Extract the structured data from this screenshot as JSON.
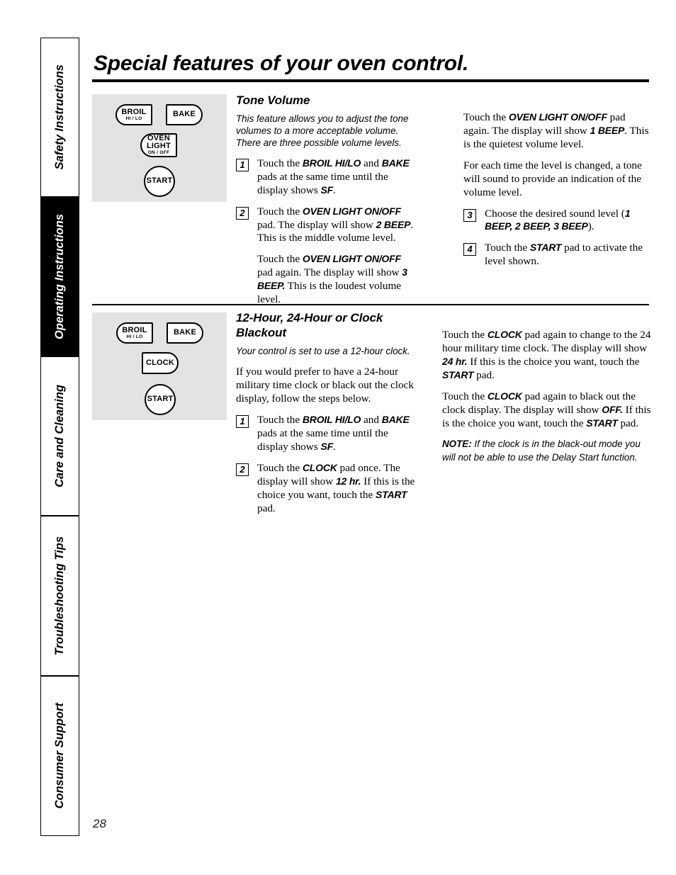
{
  "page": {
    "title": "Special features of your oven control.",
    "number": "28"
  },
  "sidebar": {
    "tabs": [
      {
        "label": "Safety Instructions",
        "active": false
      },
      {
        "label": "Operating Instructions",
        "active": true
      },
      {
        "label": "Care and Cleaning",
        "active": false
      },
      {
        "label": "Troubleshooting Tips",
        "active": false
      },
      {
        "label": "Consumer Support",
        "active": false
      }
    ]
  },
  "pads": {
    "broil": {
      "line1": "BROIL",
      "line2": "HI / LO"
    },
    "bake": {
      "line1": "BAKE"
    },
    "oven_light": {
      "line1": "OVEN",
      "line2": "LIGHT",
      "line3": "ON / OFF"
    },
    "clock": {
      "line1": "CLOCK"
    },
    "start": {
      "line1": "START"
    }
  },
  "sections": [
    {
      "id": "tone-volume",
      "heading": "Tone Volume",
      "intro": "This feature allows you to adjust the tone volumes to a more acceptable volume. There are three possible volume levels.",
      "panel_pads": [
        "broil",
        "bake",
        "oven_light",
        "start"
      ],
      "steps": [
        {
          "num": "1",
          "text_parts": [
            "Touch the ",
            "BROIL HI/LO",
            " and ",
            "BAKE",
            " pads at the same time until the display shows ",
            "SF",
            "."
          ]
        },
        {
          "num": "2",
          "text_parts": [
            "Touch the ",
            "OVEN LIGHT ON/OFF",
            " pad. The display will show ",
            "2 BEEP",
            ". This is the middle volume level."
          ]
        },
        {
          "num": "3",
          "text_parts": [
            "Choose the desired sound level (",
            "1 BEEP, 2 BEEP, 3 BEEP",
            ")."
          ]
        },
        {
          "num": "4",
          "text_parts": [
            "Touch the ",
            "START",
            " pad to activate the level shown."
          ]
        }
      ],
      "substeps": [
        "Touch the OVEN LIGHT ON/OFF pad again. The display will show 3 BEEP. This is the loudest volume level.",
        "Touch the OVEN LIGHT ON/OFF pad again. The display will show 1 BEEP. This is the quietest volume level.",
        "For each time the level is changed, a tone will sound to provide an indication of the volume level."
      ]
    },
    {
      "id": "clock-blackout",
      "heading": "12-Hour, 24-Hour or Clock Blackout",
      "intro": "Your control is set to use a 12-hour clock.",
      "body": "If you would prefer to have a 24-hour military time clock or black out the clock display, follow the steps below.",
      "panel_pads": [
        "broil",
        "bake",
        "clock",
        "start"
      ],
      "steps": [
        {
          "num": "1"
        },
        {
          "num": "2"
        }
      ],
      "note_lead": "NOTE:",
      "note_body": " If the clock is in the black-out mode you will not be able to use the Delay Start function."
    }
  ],
  "text": {
    "s1_step1_a": "Touch the ",
    "s1_step1_b": "BROIL HI/LO",
    "s1_step1_c": " and ",
    "s1_step1_d": "BAKE",
    "s1_step1_e": " pads at the same time until the display shows ",
    "s1_step1_f": "SF",
    "s1_step1_g": ".",
    "s1_step2_a": "Touch the ",
    "s1_step2_b": "OVEN LIGHT ON/OFF",
    "s1_step2_c": " pad. The display will show ",
    "s1_step2_d": "2 BEEP",
    "s1_step2_e": ". This is the middle volume level.",
    "s1_sub_loud_a": "Touch the ",
    "s1_sub_loud_b": "OVEN LIGHT ON/OFF",
    "s1_sub_loud_c": " pad again. The display will show ",
    "s1_sub_loud_d": "3 BEEP.",
    "s1_sub_loud_e": " This is the loudest volume level.",
    "s1_sub_quiet_a": "Touch the ",
    "s1_sub_quiet_b": "OVEN LIGHT ON/OFF",
    "s1_sub_quiet_c": " pad again. The display will show ",
    "s1_sub_quiet_d": "1 BEEP",
    "s1_sub_quiet_e": ". This is the quietest volume level.",
    "s1_sub_tone": "For each time the level is changed, a tone will sound to provide an indication of the volume level.",
    "s1_step3_a": "Choose the desired sound level (",
    "s1_step3_b": "1 BEEP, 2 BEEP, 3 BEEP",
    "s1_step3_c": ").",
    "s1_step4_a": "Touch the ",
    "s1_step4_b": "START",
    "s1_step4_c": " pad to activate the level shown.",
    "s2_step1_a": "Touch the ",
    "s2_step1_b": "BROIL HI/LO",
    "s2_step1_c": " and ",
    "s2_step1_d": "BAKE",
    "s2_step1_e": " pads at the same time until the display shows ",
    "s2_step1_f": "SF",
    "s2_step1_g": ".",
    "s2_step2_a": "Touch the ",
    "s2_step2_b": "CLOCK",
    "s2_step2_c": " pad once. The display will show ",
    "s2_step2_d": "12 hr.",
    "s2_step2_e": " If this is the choice you want, touch the ",
    "s2_step2_f": "START",
    "s2_step2_g": " pad.",
    "s2_r1_a": "Touch the ",
    "s2_r1_b": "CLOCK",
    "s2_r1_c": " pad again to change to the 24 hour military time clock. The display will show ",
    "s2_r1_d": "24 hr.",
    "s2_r1_e": " If this is the choice you want, touch the ",
    "s2_r1_f": "START",
    "s2_r1_g": " pad.",
    "s2_r2_a": "Touch the ",
    "s2_r2_b": "CLOCK",
    "s2_r2_c": " pad again to black out the clock display. The display will show ",
    "s2_r2_d": "OFF.",
    "s2_r2_e": " If this is the choice you want, touch the ",
    "s2_r2_f": "START",
    "s2_r2_g": " pad.",
    "s2_note_lead": "NOTE:",
    "s2_note_body": " If the clock is in the black-out mode you will not be able to use the Delay Start function."
  }
}
